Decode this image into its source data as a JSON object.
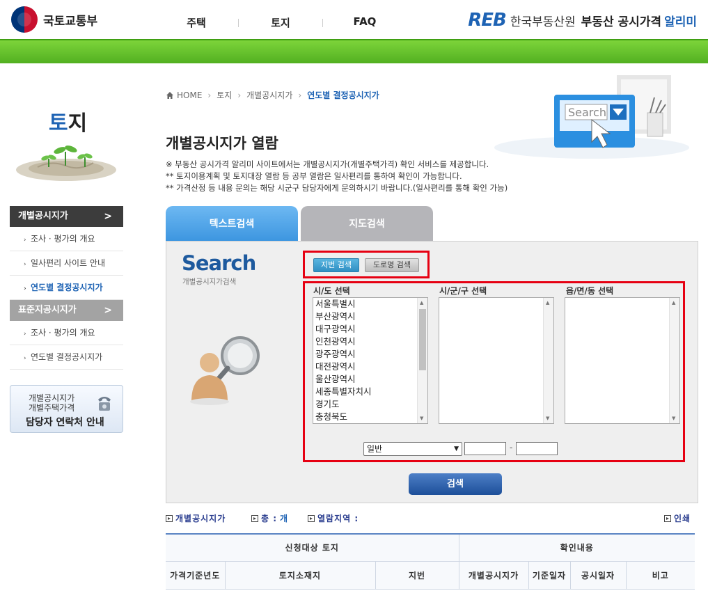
{
  "header": {
    "ministry_logo_text": "국토교통부",
    "nav": [
      "주택",
      "토지",
      "FAQ"
    ],
    "reb_mark": "REB",
    "brand_org": "한국부동산원",
    "brand_service": "부동산 공시가격",
    "brand_service_accent": "알리미"
  },
  "sidebar": {
    "title_accent": "토",
    "title_rest": "지",
    "menu": [
      {
        "label": "개별공시지가",
        "chevron": ">",
        "subs": [
          "조사 · 평가의 개요",
          "일사편리 사이트 안내",
          "연도별 결정공시지가"
        ]
      },
      {
        "label": "표준지공시지가",
        "chevron": ">",
        "subs": [
          "조사 · 평가의 개요",
          "연도별 결정공시지가"
        ]
      }
    ],
    "active_sub": "연도별 결정공시지가",
    "contact": {
      "line1": "개별공시지가",
      "line2": "개별주택가격",
      "line3": "담당자 연락처 안내"
    }
  },
  "breadcrumb": {
    "home": "HOME",
    "items": [
      "토지",
      "개별공시지가",
      "연도별 결정공시지가"
    ]
  },
  "hero_search_text": "Search",
  "page": {
    "title": "개별공시지가 열람",
    "notes": [
      "※ 부동산 공시가격 알리미 사이트에서는 개별공시지가(개별주택가격) 확인 서비스를 제공합니다.",
      "** 토지이용계획 및 토지대장 열람 등 공부 열람은 일사편리를 통하여 확인이 가능합니다.",
      "** 가격산정 등 내용 문의는 해당 시군구 담당자에게 문의하시기 바랍니다.(일사편리를 통해 확인 가능)"
    ]
  },
  "tabs": {
    "text_search": "텍스트검색",
    "map_search": "지도검색"
  },
  "search": {
    "logo": "Search",
    "logo_sub": "개별공시지가검색",
    "btn_jibun": "지번 검색",
    "btn_road": "도로명 검색",
    "col_sido": "시/도 선택",
    "col_sigungu": "시/군/구 선택",
    "col_eupmyeondong": "읍/면/동 선택",
    "sido_options": [
      "서울특별시",
      "부산광역시",
      "대구광역시",
      "인천광역시",
      "광주광역시",
      "대전광역시",
      "울산광역시",
      "세종특별자치시",
      "경기도",
      "충청북도"
    ],
    "land_type_selected": "일반",
    "dash": "-",
    "submit": "검색"
  },
  "result": {
    "label_price": "개별공시지가",
    "label_total": "총 :",
    "total_unit": "개",
    "label_region": "열람지역 :",
    "print": "인쇄"
  },
  "table": {
    "group_request": "신청대상 토지",
    "group_confirm": "확인내용",
    "headers": [
      "가격기준년도",
      "토지소재지",
      "지번",
      "개별공시지가",
      "기준일자",
      "공시일자",
      "비고"
    ]
  },
  "colors": {
    "accent": "#1e63b4",
    "green": "#52b021",
    "highlight_red": "#e60012"
  }
}
